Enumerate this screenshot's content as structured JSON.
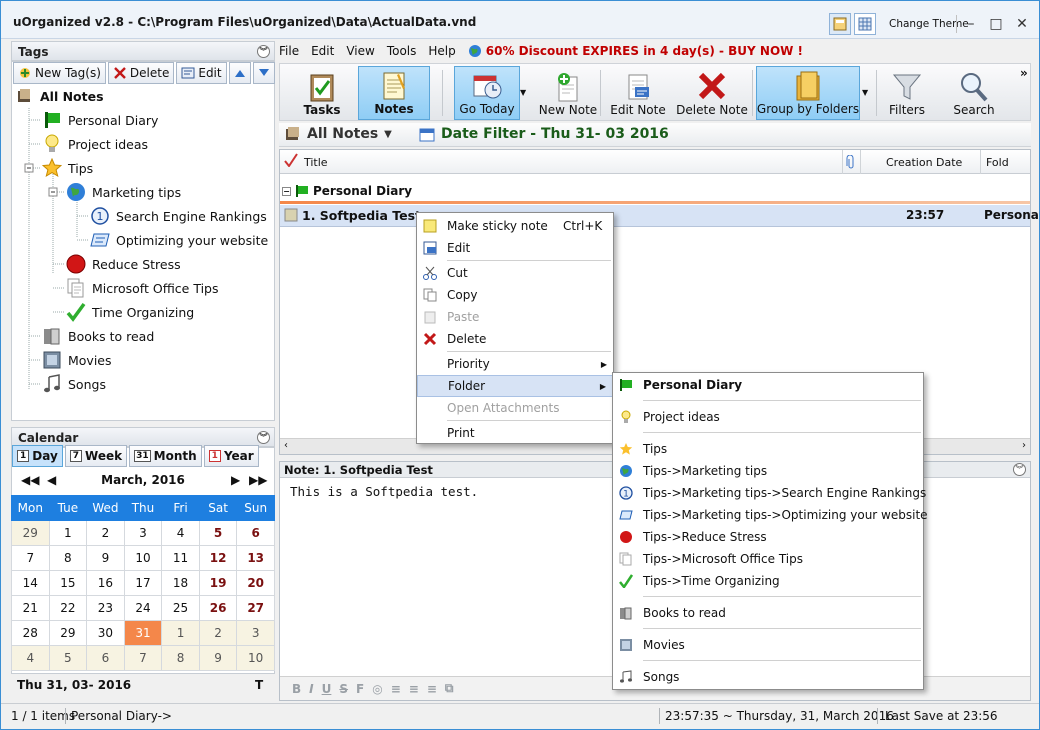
{
  "window": {
    "title": "uOrganized v2.8 - C:\\Program Files\\uOrganized\\Data\\ActualData.vnd",
    "change_theme": "Change Theme"
  },
  "tags_panel": {
    "header": "Tags",
    "buttons": {
      "new": "New Tag(s)",
      "delete": "Delete",
      "edit": "Edit"
    },
    "all_notes": "All Notes",
    "items": [
      {
        "label": "Personal Diary",
        "icon": "green-flag-icon"
      },
      {
        "label": "Project ideas",
        "icon": "lightbulb-icon"
      },
      {
        "label": "Tips",
        "icon": "star-icon"
      },
      {
        "label": "Marketing tips",
        "icon": "globe-icon"
      },
      {
        "label": "Search Engine Rankings",
        "icon": "number-one-icon"
      },
      {
        "label": "Optimizing your website",
        "icon": "card-icon"
      },
      {
        "label": "Reduce Stress",
        "icon": "red-circle-icon"
      },
      {
        "label": "Microsoft Office Tips",
        "icon": "documents-icon"
      },
      {
        "label": "Time Organizing",
        "icon": "checkmark-icon"
      },
      {
        "label": "Books to read",
        "icon": "book-icon"
      },
      {
        "label": "Movies",
        "icon": "film-icon"
      },
      {
        "label": "Songs",
        "icon": "music-note-icon"
      }
    ]
  },
  "calendar": {
    "header": "Calendar",
    "views": [
      "Day",
      "Week",
      "Month",
      "Year"
    ],
    "view_icons": [
      "1",
      "7",
      "31",
      "1"
    ],
    "month": "March, 2016",
    "weekdays": [
      "Mon",
      "Tue",
      "Wed",
      "Thu",
      "Fri",
      "Sat",
      "Sun"
    ],
    "weeks": [
      [
        "29",
        "1",
        "2",
        "3",
        "4",
        "5",
        "6"
      ],
      [
        "7",
        "8",
        "9",
        "10",
        "11",
        "12",
        "13"
      ],
      [
        "14",
        "15",
        "16",
        "17",
        "18",
        "19",
        "20"
      ],
      [
        "21",
        "22",
        "23",
        "24",
        "25",
        "26",
        "27"
      ],
      [
        "28",
        "29",
        "30",
        "31",
        "1",
        "2",
        "3"
      ],
      [
        "4",
        "5",
        "6",
        "7",
        "8",
        "9",
        "10"
      ]
    ],
    "selected_date": "Thu 31, 03- 2016",
    "today_btn": "T"
  },
  "menu": [
    "File",
    "Edit",
    "View",
    "Tools",
    "Help"
  ],
  "promo": "60% Discount EXPIRES in 4 day(s) - BUY NOW !",
  "toolbar": {
    "tasks": "Tasks",
    "notes": "Notes",
    "go_today": "Go Today",
    "new_note": "New Note",
    "edit_note": "Edit Note",
    "delete_note": "Delete Note",
    "group_by": "Group by Folders",
    "filters": "Filters",
    "search": "Search",
    "more": "»"
  },
  "filterbar": {
    "view": "All Notes",
    "date_filter": "Date Filter -  Thu 31- 03 2016"
  },
  "grid": {
    "columns": {
      "title": "Title",
      "creation_date": "Creation Date",
      "folder": "Fold"
    },
    "group": "Personal Diary",
    "row": {
      "title": "1. Softpedia Test",
      "time": "23:57",
      "folder": "Persona"
    }
  },
  "note": {
    "header": "Note: 1. Softpedia Test",
    "body": "This is a Softpedia test."
  },
  "context_menu": {
    "items": [
      {
        "label": "Make sticky note",
        "shortcut": "Ctrl+K"
      },
      {
        "label": "Edit"
      },
      {
        "label": "Cut"
      },
      {
        "label": "Copy"
      },
      {
        "label": "Paste"
      },
      {
        "label": "Delete"
      },
      {
        "label": "Priority"
      },
      {
        "label": "Folder"
      },
      {
        "label": "Open Attachments"
      },
      {
        "label": "Print"
      }
    ]
  },
  "folder_submenu": [
    "Personal Diary",
    "Project ideas",
    "Tips",
    "Tips->Marketing tips",
    "Tips->Marketing tips->Search Engine Rankings",
    "Tips->Marketing tips->Optimizing your website",
    "Tips->Reduce Stress",
    "Tips->Microsoft Office Tips",
    "Tips->Time Organizing",
    "Books to read",
    "Movies",
    "Songs"
  ],
  "status": {
    "count": "1 / 1 items",
    "path": "Personal Diary->",
    "datetime": "23:57:35  ~  Thursday, 31, March 2016",
    "last_save": "Last Save at 23:56"
  },
  "colors": {
    "accent": "#1e7fe0",
    "selected_toolbar": "#8fcdf5",
    "promo": "#c00000",
    "date_filter": "#1a5c1a",
    "today_cell": "#f4874a"
  }
}
